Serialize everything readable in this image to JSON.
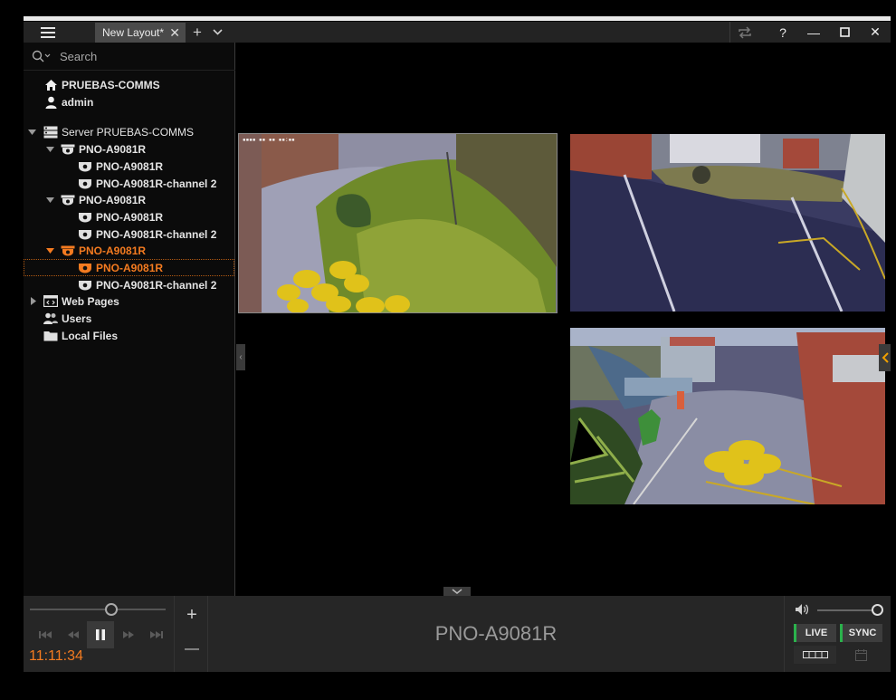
{
  "titlebar": {
    "tab_label": "New Layout*",
    "close_tab": "✕",
    "add_tab": "+",
    "help": "?",
    "minimize": "—",
    "close": "✕"
  },
  "search": {
    "placeholder": "Search"
  },
  "tree": {
    "system_name": "PRUEBAS-COMMS",
    "user": "admin",
    "server": "Server PRUEBAS-COMMS",
    "device_1": "PNO-A9081R",
    "device_1_ch1": "PNO-A9081R",
    "device_1_ch2": "PNO-A9081R-channel 2",
    "device_2": "PNO-A9081R",
    "device_2_ch1": "PNO-A9081R",
    "device_2_ch2": "PNO-A9081R-channel 2",
    "device_3": "PNO-A9081R",
    "device_3_ch1": "PNO-A9081R",
    "device_3_ch2": "PNO-A9081R-channel 2",
    "web_pages": "Web Pages",
    "users": "Users",
    "local_files": "Local Files"
  },
  "bottom": {
    "time": "11:11:34",
    "zoom_in": "+",
    "zoom_out": "—",
    "camera_name": "PNO-A9081R",
    "live_label": "LIVE",
    "sync_label": "SYNC"
  },
  "colors": {
    "accent": "#f47b20",
    "live_indicator": "#2bb24c"
  }
}
